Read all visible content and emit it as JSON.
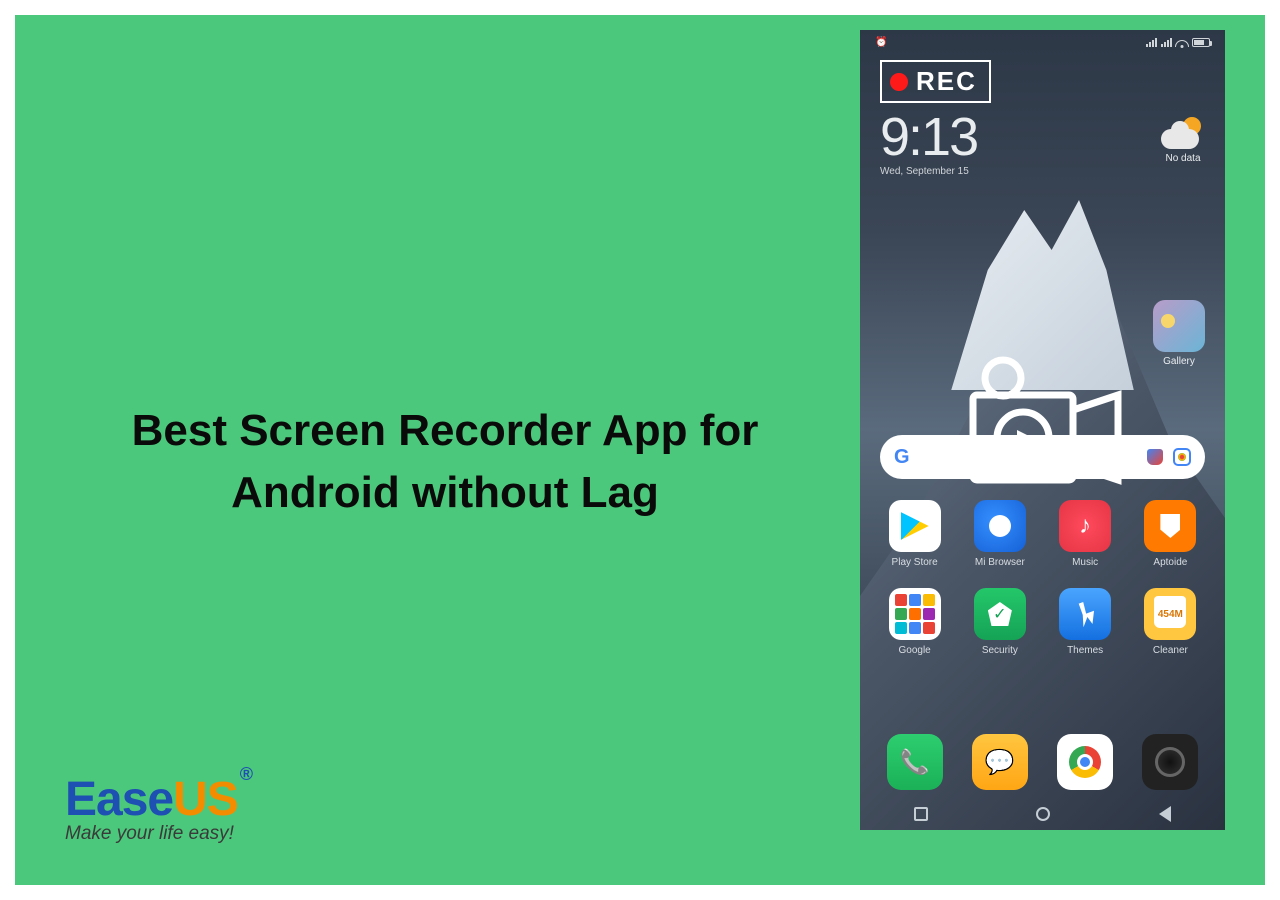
{
  "title": "Best Screen Recorder App for Android without Lag",
  "brand": {
    "ease": "Ease",
    "us": "US",
    "reg": "®",
    "tagline": "Make your life easy!"
  },
  "rec": {
    "label": "REC"
  },
  "clock": {
    "time": "9:13",
    "date": "Wed, September 15"
  },
  "weather": {
    "label": "No data"
  },
  "gallery": {
    "label": "Gallery"
  },
  "apps": [
    {
      "name": "play-store",
      "label": "Play Store",
      "icoClass": "ps"
    },
    {
      "name": "mi-browser",
      "label": "Mi Browser",
      "icoClass": "mb"
    },
    {
      "name": "music",
      "label": "Music",
      "icoClass": "mu"
    },
    {
      "name": "aptoide",
      "label": "Aptoide",
      "icoClass": "ap"
    },
    {
      "name": "google-folder",
      "label": "Google",
      "icoClass": "gf"
    },
    {
      "name": "security",
      "label": "Security",
      "icoClass": "se"
    },
    {
      "name": "themes",
      "label": "Themes",
      "icoClass": "th"
    },
    {
      "name": "cleaner",
      "label": "Cleaner",
      "icoClass": "cl"
    }
  ],
  "dock": [
    {
      "name": "phone",
      "icoClass": "ph"
    },
    {
      "name": "messages",
      "icoClass": "sm"
    },
    {
      "name": "chrome",
      "icoClass": "ch"
    },
    {
      "name": "camera",
      "icoClass": "ca"
    }
  ]
}
